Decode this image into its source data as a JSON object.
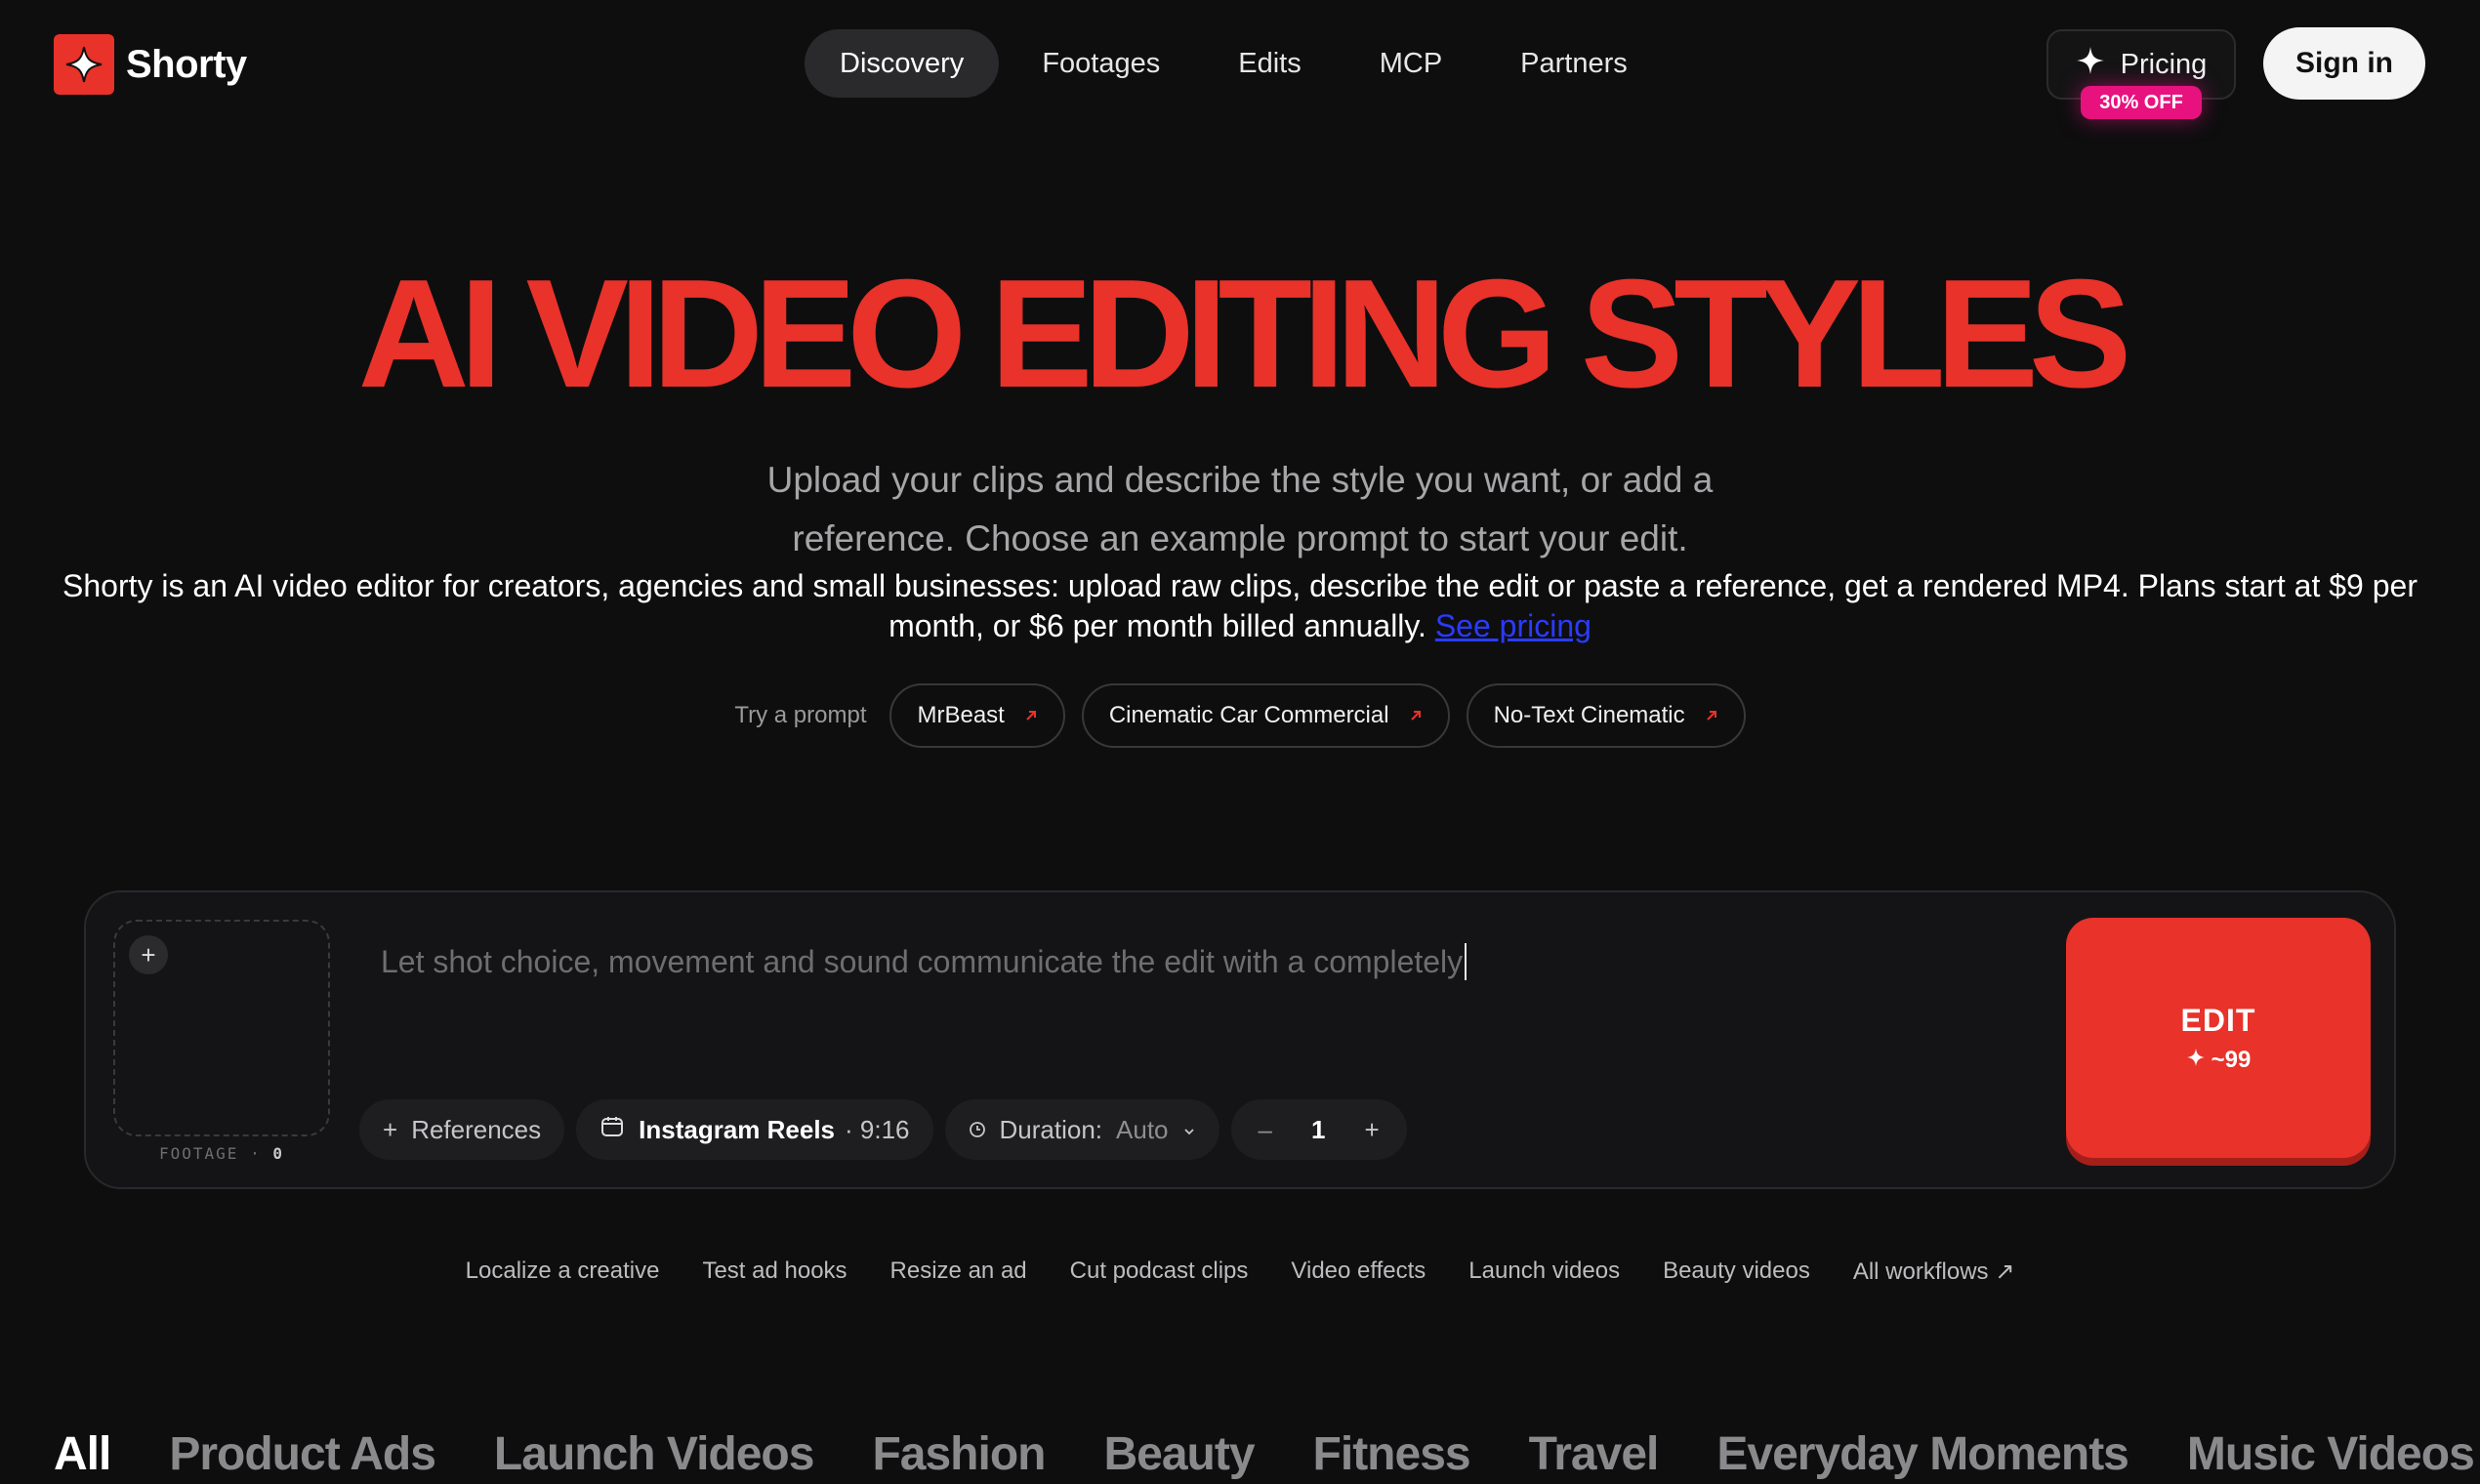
{
  "brand": {
    "name": "Shorty",
    "accent": "#e8322a"
  },
  "nav": {
    "items": [
      "Discovery",
      "Footages",
      "Edits",
      "MCP",
      "Partners"
    ],
    "active": "Discovery"
  },
  "header": {
    "pricing_label": "Pricing",
    "discount_badge": "30% OFF",
    "signin_label": "Sign in"
  },
  "hero": {
    "title": "AI VIDEO EDITING STYLES",
    "subtitle": "Upload your clips and describe the style you want, or add a reference. Choose an example prompt to start your edit.",
    "description": "Shorty is an AI video editor for creators, agencies and small businesses: upload raw clips, describe the edit or paste a reference, get a rendered MP4. Plans start at $9 per month, or $6 per month billed annually.",
    "pricing_link": "See pricing"
  },
  "prompts": {
    "label": "Try a prompt",
    "chips": [
      "MrBeast",
      "Cinematic Car Commercial",
      "No-Text Cinematic"
    ]
  },
  "composer": {
    "footage_label": "FOOTAGE",
    "footage_separator": "·",
    "footage_count": "0",
    "prompt_text": "Let shot choice, movement and sound communicate the edit with a completely",
    "references_label": "References",
    "platform_label": "Instagram Reels",
    "platform_ratio": "· 9:16",
    "duration_label": "Duration:",
    "duration_value": "Auto",
    "quantity": "1",
    "edit_label": "EDIT",
    "edit_credits": "~99"
  },
  "workflows": {
    "items": [
      "Localize a creative",
      "Test ad hooks",
      "Resize an ad",
      "Cut podcast clips",
      "Video effects",
      "Launch videos",
      "Beauty videos"
    ],
    "all_label": "All workflows ↗"
  },
  "categories": {
    "items": [
      "All",
      "Product Ads",
      "Launch Videos",
      "Fashion",
      "Beauty",
      "Fitness",
      "Travel",
      "Everyday Moments",
      "Music Videos"
    ],
    "active": "All"
  },
  "icons": [
    "sparkle-logo-icon",
    "sparkle-icon",
    "arrow-up-right-icon",
    "plus-icon",
    "calendar-icon",
    "clock-icon",
    "chevron-down-icon",
    "minus-icon"
  ]
}
